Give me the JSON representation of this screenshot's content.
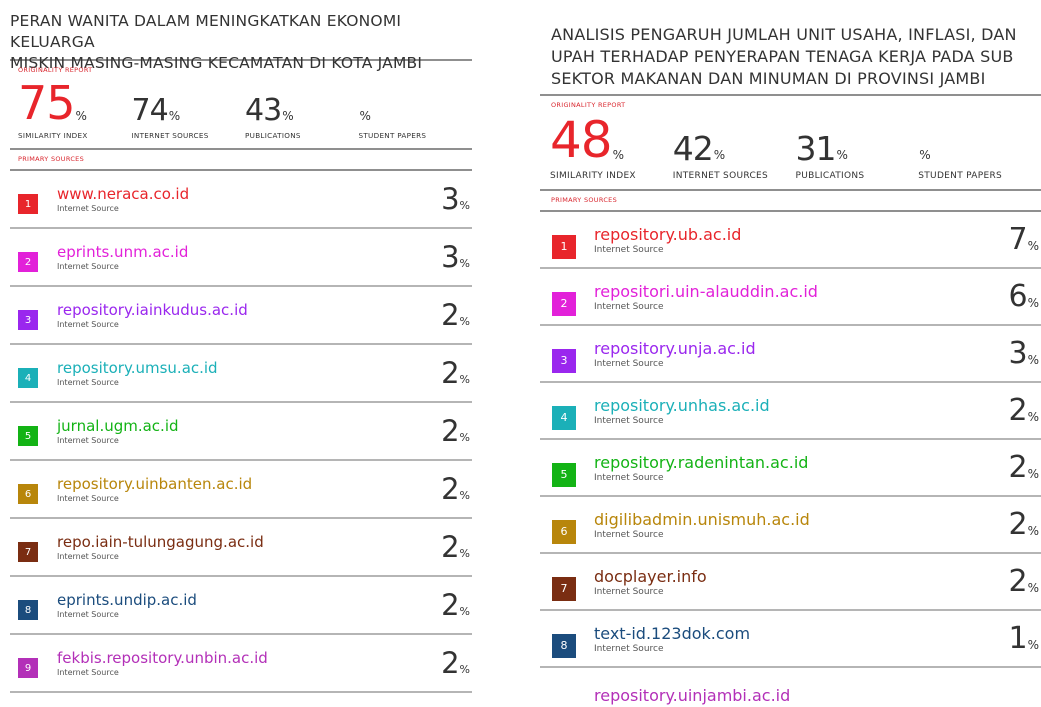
{
  "left_report": {
    "title": "PERAN WANITA DALAM MENINGKATKAN EKONOMI KELUARGA\nMISKIN MASING-MASING KECAMATAN DI KOTA JAMBI",
    "originality_label": "ORIGINALITY REPORT",
    "stats": {
      "similarity_index": {
        "value": "75",
        "unit": "%",
        "label": "SIMILARITY INDEX"
      },
      "internet_sources": {
        "value": "74",
        "unit": "%",
        "label": "INTERNET SOURCES"
      },
      "publications": {
        "value": "43",
        "unit": "%",
        "label": "PUBLICATIONS"
      },
      "student_papers": {
        "value": "",
        "unit": "%",
        "label": "STUDENT PAPERS"
      }
    },
    "primary_label": "PRIMARY SOURCES",
    "sources": [
      {
        "rank": "1",
        "name": "www.neraca.co.id",
        "type": "Internet Source",
        "pct": "3",
        "unit": "%",
        "color": "#e8252b"
      },
      {
        "rank": "2",
        "name": "eprints.unm.ac.id",
        "type": "Internet Source",
        "pct": "3",
        "unit": "%",
        "color": "#e221d9"
      },
      {
        "rank": "3",
        "name": "repository.iainkudus.ac.id",
        "type": "Internet Source",
        "pct": "2",
        "unit": "%",
        "color": "#9a27ee"
      },
      {
        "rank": "4",
        "name": "repository.umsu.ac.id",
        "type": "Internet Source",
        "pct": "2",
        "unit": "%",
        "color": "#1bb0b8"
      },
      {
        "rank": "5",
        "name": "jurnal.ugm.ac.id",
        "type": "Internet Source",
        "pct": "2",
        "unit": "%",
        "color": "#13b315"
      },
      {
        "rank": "6",
        "name": "repository.uinbanten.ac.id",
        "type": "Internet Source",
        "pct": "2",
        "unit": "%",
        "color": "#b8860b"
      },
      {
        "rank": "7",
        "name": "repo.iain-tulungagung.ac.id",
        "type": "Internet Source",
        "pct": "2",
        "unit": "%",
        "color": "#7a2d12"
      },
      {
        "rank": "8",
        "name": "eprints.undip.ac.id",
        "type": "Internet Source",
        "pct": "2",
        "unit": "%",
        "color": "#1b4c7d"
      },
      {
        "rank": "9",
        "name": "fekbis.repository.unbin.ac.id",
        "type": "Internet Source",
        "pct": "2",
        "unit": "%",
        "color": "#b330b8"
      }
    ]
  },
  "right_report": {
    "title": "ANALISIS PENGARUH JUMLAH UNIT USAHA, INFLASI, DAN\nUPAH TERHADAP PENYERAPAN TENAGA KERJA PADA SUB\nSEKTOR MAKANAN DAN MINUMAN DI PROVINSI JAMBI",
    "originality_label": "ORIGINALITY REPORT",
    "stats": {
      "similarity_index": {
        "value": "48",
        "unit": "%",
        "label": "SIMILARITY INDEX"
      },
      "internet_sources": {
        "value": "42",
        "unit": "%",
        "label": "INTERNET SOURCES"
      },
      "publications": {
        "value": "31",
        "unit": "%",
        "label": "PUBLICATIONS"
      },
      "student_papers": {
        "value": "",
        "unit": "%",
        "label": "STUDENT PAPERS"
      }
    },
    "primary_label": "PRIMARY SOURCES",
    "sources": [
      {
        "rank": "1",
        "name": "repository.ub.ac.id",
        "type": "Internet Source",
        "pct": "7",
        "unit": "%",
        "color": "#e8252b"
      },
      {
        "rank": "2",
        "name": "repositori.uin-alauddin.ac.id",
        "type": "Internet Source",
        "pct": "6",
        "unit": "%",
        "color": "#e221d9"
      },
      {
        "rank": "3",
        "name": "repository.unja.ac.id",
        "type": "Internet Source",
        "pct": "3",
        "unit": "%",
        "color": "#9a27ee"
      },
      {
        "rank": "4",
        "name": "repository.unhas.ac.id",
        "type": "Internet Source",
        "pct": "2",
        "unit": "%",
        "color": "#1bb0b8"
      },
      {
        "rank": "5",
        "name": "repository.radenintan.ac.id",
        "type": "Internet Source",
        "pct": "2",
        "unit": "%",
        "color": "#13b315"
      },
      {
        "rank": "6",
        "name": "digilibadmin.unismuh.ac.id",
        "type": "Internet Source",
        "pct": "2",
        "unit": "%",
        "color": "#b8860b"
      },
      {
        "rank": "7",
        "name": "docplayer.info",
        "type": "Internet Source",
        "pct": "2",
        "unit": "%",
        "color": "#7a2d12"
      },
      {
        "rank": "8",
        "name": "text-id.123dok.com",
        "type": "Internet Source",
        "pct": "1",
        "unit": "%",
        "color": "#1b4c7d"
      },
      {
        "rank": "",
        "name": "repository.uinjambi.ac.id",
        "type": "",
        "pct": "",
        "unit": "",
        "color": "#b330b8"
      }
    ]
  }
}
